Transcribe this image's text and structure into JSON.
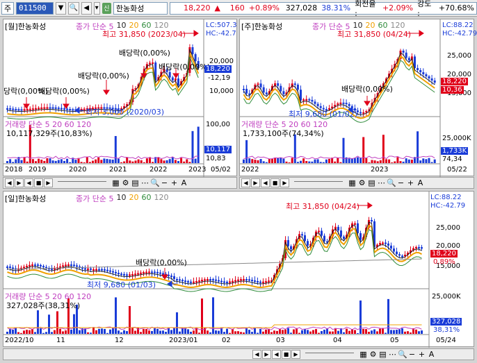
{
  "toolbar": {
    "market": "주",
    "code": "011500",
    "search_icon": "magnifier-icon",
    "name": "한농화성",
    "badge": "신",
    "price": "18,220",
    "change": "160",
    "change_pct": "+0.89%",
    "volume": "327,028",
    "vol_ratio": "38.31%",
    "turnover_label": "회전율 :",
    "turnover": "+2.09%",
    "strength_label": "강도 :",
    "strength": "+70.68%"
  },
  "monthly": {
    "header": "[월]한농화성",
    "ma_label": "종가 단순 5",
    "ma_periods": [
      "10",
      "20",
      "60",
      "120"
    ],
    "lc": "LC:507.3",
    "hc": "HC:-42.7",
    "high_label": "최고 31,850 (2023/04)",
    "low_label": "최저 3,000 (2020/03)",
    "div1": "배당락(0,00%)",
    "div2": "배당락(0,00%)",
    "div3": "배당락(0,00%)",
    "div4": "배당락(0,00%)",
    "div5": "당락(0,00%)",
    "y_ticks": [
      "20,000",
      "10,000"
    ],
    "price_tag": "18,220",
    "price_tag2": "-12,19",
    "vol_label": "거래량 단순 5 20 60 120",
    "vol_text": "10,117,329주(10,83%)",
    "vol_tick": "100,00",
    "vol_tag": "10,117",
    "vol_tag2": "10,83",
    "x_ticks": [
      "2018",
      "2019",
      "2020",
      "2021",
      "2022",
      "2023",
      "05/02"
    ]
  },
  "weekly": {
    "header": "[주]한농화성",
    "ma_label": "종가 단순 5",
    "ma_periods": [
      "10",
      "20",
      "60",
      "120"
    ],
    "lc": "LC:88.22",
    "hc": "HC:-42.79",
    "high_label": "최고 31,850 (04/24)",
    "low_label": "최저 9,680 (01/02)",
    "div": "배당락(0,00%)",
    "y_ticks": [
      "25,000",
      "20,000",
      "15,000"
    ],
    "price_tag": "18,220",
    "price_tag2": "10,36",
    "vol_label": "거래량 단순 5 20 60 120",
    "vol_text": "1,733,100주(74,34%)",
    "vol_tick": "25,000K",
    "vol_tag": "1,733K",
    "vol_tag2": "74,34",
    "x_ticks": [
      "2022",
      "2023",
      "05/22"
    ]
  },
  "daily": {
    "header": "[일]한농화성",
    "ma_label": "종가 단순 5",
    "ma_periods": [
      "10",
      "20",
      "60",
      "120"
    ],
    "lc": "LC:88.22",
    "hc": "HC:-42.79",
    "high_label": "최고 31,850 (04/24)",
    "low_label": "최저 9,680 (01/03)",
    "div": "배당락(0,00%)",
    "y_ticks": [
      "25,000",
      "20,000",
      "15,000"
    ],
    "price_tag": "18,220",
    "price_tag2": "0,89%",
    "vol_label": "거래량 단순 5 20 60 120",
    "vol_text": "327,028주(38,31%)",
    "vol_tick": "25,000K",
    "vol_tag": "327,028",
    "vol_tag2": "38,31%",
    "x_ticks": [
      "2022/10",
      "11",
      "12",
      "2023/01",
      "02",
      "03",
      "04",
      "05",
      "05/24"
    ]
  },
  "colors": {
    "up": "#e0001a",
    "down": "#1a3cd8",
    "ma5": "#222222",
    "ma20": "#f0a000",
    "ma60": "#2e8b3a",
    "ma120": "#8a8a8a"
  },
  "chart_data": [
    {
      "type": "line",
      "title": "[월]한농화성",
      "x": [
        "2018",
        "2019",
        "2020",
        "2021",
        "2022",
        "2023"
      ],
      "series": [
        {
          "name": "종가",
          "values": [
            4500,
            4200,
            3600,
            9000,
            12000,
            18220
          ]
        }
      ]
    },
    {
      "type": "line",
      "title": "[주]한농화성",
      "x": [
        "2022",
        "2023",
        "05/22"
      ],
      "series": [
        {
          "name": "종가",
          "values": [
            13000,
            11000,
            18220
          ]
        }
      ]
    },
    {
      "type": "line",
      "title": "[일]한농화성",
      "x": [
        "2022/10",
        "11",
        "12",
        "2023/01",
        "02",
        "03",
        "04",
        "05"
      ],
      "series": [
        {
          "name": "종가",
          "values": [
            12800,
            12300,
            11500,
            10200,
            10600,
            17000,
            21000,
            18220
          ]
        }
      ]
    }
  ]
}
